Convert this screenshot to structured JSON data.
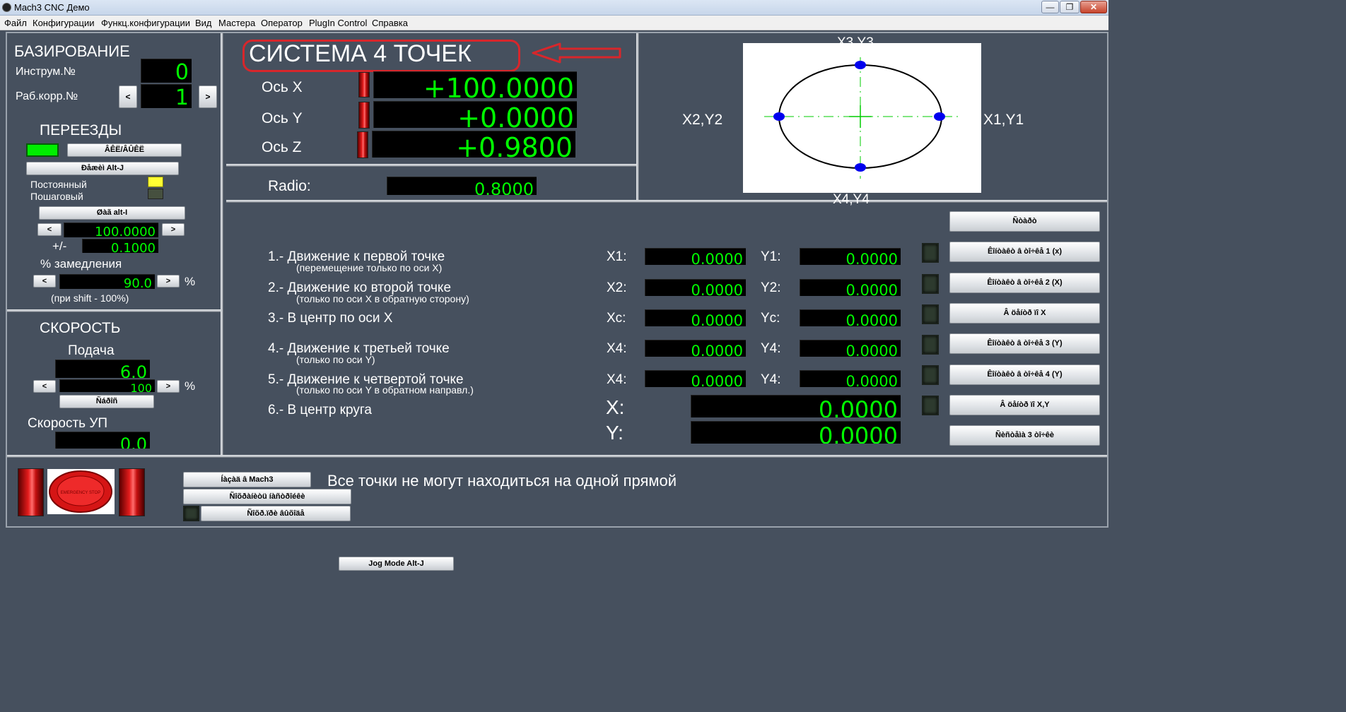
{
  "window": {
    "title": "Mach3 CNC  Демо"
  },
  "menu": [
    "Файл",
    "Конфигурации",
    "Функц.конфигурации",
    "Вид",
    "Мастера",
    "Оператор",
    "PlugIn Control",
    "Справка"
  ],
  "homing": {
    "title": "БАЗИРОВАНИЕ",
    "tool_label": "Инструм.№",
    "tool_value": "0",
    "offset_label": "Раб.корр.№",
    "offset_value": "1",
    "prev": "<",
    "next": ">"
  },
  "jog": {
    "title": "ПЕРЕЕЗДЫ",
    "toggle_button": "ÂÊË/ÂÛÊË",
    "mode_button": "Ðåæèì Alt-J",
    "continuous": "Постоянный",
    "step": "Пошаговый",
    "step_button": "Øàã alt-I",
    "step_value": "100.0000",
    "plusminus_label": "+/-",
    "plusminus_value": "0.1000",
    "slow_label": "% замедления",
    "slow_value": "90.0",
    "slow_unit": "%",
    "shift_note": "(при shift - 100%)",
    "prev": "<",
    "next": ">",
    "continuous_color": "#ffff33"
  },
  "speed": {
    "title": "СКОРОСТЬ",
    "feed_label": "Подача",
    "feed_value": "6.0",
    "feed_override": "100",
    "feed_unit": "%",
    "reset_button": "Ñáðîñ",
    "program_speed_label": "Скорость УП",
    "program_speed_value": "0.0",
    "prev": "<",
    "next": ">"
  },
  "system": {
    "title": "СИСТЕМА 4 ТОЧЕК",
    "axes": [
      {
        "label": "Ось X",
        "value": "+100.0000"
      },
      {
        "label": "Ось Y",
        "value": "+0.0000"
      },
      {
        "label": "Ось Z",
        "value": "+0.9800"
      }
    ],
    "radio_label": "Radio:",
    "radio_value": "0.8000",
    "annotation_color": "#d8262b"
  },
  "diagram": {
    "top": "X3,Y3",
    "left": "X2,Y2",
    "right": "X1,Y1",
    "bottom": "X4,Y4"
  },
  "steps": [
    {
      "main": "1.- Движение к первой точке",
      "sub": "(перемещение только по оси X)",
      "xl": "X1:",
      "x": "0.0000",
      "yl": "Y1:",
      "y": "0.0000"
    },
    {
      "main": "2.- Движение ко второй точке",
      "sub": "(только по оси X в обратную сторону)",
      "xl": "X2:",
      "x": "0.0000",
      "yl": "Y2:",
      "y": "0.0000"
    },
    {
      "main": "3.- В центр по оси X",
      "sub": "",
      "xl": "Xc:",
      "x": "0.0000",
      "yl": "Yc:",
      "y": "0.0000"
    },
    {
      "main": "4.- Движение к третьей точке",
      "sub": "(только по оси Y)",
      "xl": "X4:",
      "x": "0.0000",
      "yl": "Y4:",
      "y": "0.0000"
    },
    {
      "main": "5.- Движение к четвертой точке",
      "sub": "(только по оси Y в обратном направл.)",
      "xl": "X4:",
      "x": "0.0000",
      "yl": "Y4:",
      "y": "0.0000"
    },
    {
      "main": "6.- В центр круга",
      "sub": ""
    }
  ],
  "center": {
    "x_label": "X:",
    "x_value": "0.0000",
    "y_label": "Y:",
    "y_value": "0.0000"
  },
  "right_buttons": [
    "Ñòàðò",
    "Êîíòàêò â òî÷êå 1 (x)",
    "Êîíòàêò â òî÷êå 2 (X)",
    "Â öåíòð ïî X",
    "Êîíòàêò â òî÷êå 3 (Y)",
    "Êîíòàêò â òî÷êå 4 (Y)",
    "Â öåíòð ïî X,Y",
    "Ñèñòåìà 3 òî÷êè"
  ],
  "bottom": {
    "button1": "Íàçàä â Mach3",
    "button2": "Ñîõðàíèòü íàñòðîéêè",
    "button3": "Ñîõð.ïðè âûõîäå",
    "message": "Все точки не могут находиться на одной прямой",
    "jog_mode_button": "Jog Mode Alt-J",
    "estop_label": "EMERGENCY STOP"
  },
  "colors": {
    "background": "#46505e",
    "dro_text": "#00ff00",
    "led_on": "#00ee00",
    "estop": "#e51d1d"
  }
}
